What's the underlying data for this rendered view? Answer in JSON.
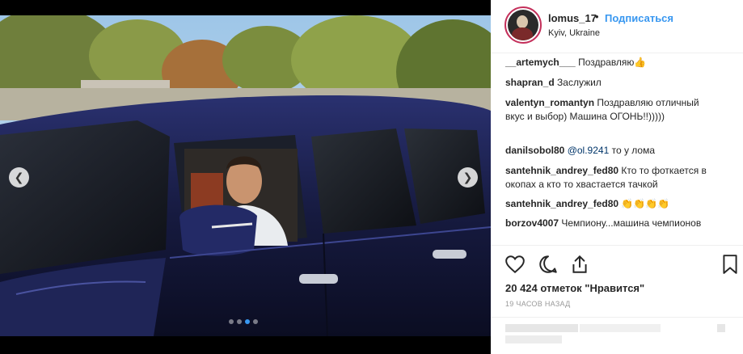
{
  "post": {
    "username": "lomus_17",
    "separator": "•",
    "follow_label": "Подписаться",
    "location": "Kyiv, Ukraine",
    "carousel": {
      "slide_count": 4,
      "active_slide": 3
    }
  },
  "comments": [
    {
      "user": "__artemych___",
      "text": " Поздравляю👍"
    },
    {
      "user": "shapran_d",
      "text": " Заслужил"
    },
    {
      "user": "valentyn_romantyn",
      "text": " Поздравляю отличный вкус и выбор) Машина ОГОНЬ!!)))))"
    },
    {
      "user": "danilsobol80",
      "mention": " @ol.9241",
      "text": " то у лома"
    },
    {
      "user": "santehnik_andrey_fed80",
      "text": " Кто то фоткается в окопах а кто то хвастается тачкой"
    },
    {
      "user": "santehnik_andrey_fed80",
      "text": " 👏👏👏👏"
    },
    {
      "user": "borzov4007",
      "text": " Чемпиону...машина чемпионов"
    }
  ],
  "stats": {
    "likes_text": "20 424 отметок \"Нравится\"",
    "time_text": "19 ЧАСОВ НАЗАД"
  },
  "colors": {
    "accent": "#3897f0",
    "text": "#262626",
    "muted": "#999999",
    "car_body": "#1c2149"
  },
  "icons": [
    "heart-icon",
    "comment-icon",
    "share-icon",
    "bookmark-icon",
    "chevron-left-icon",
    "chevron-right-icon"
  ]
}
